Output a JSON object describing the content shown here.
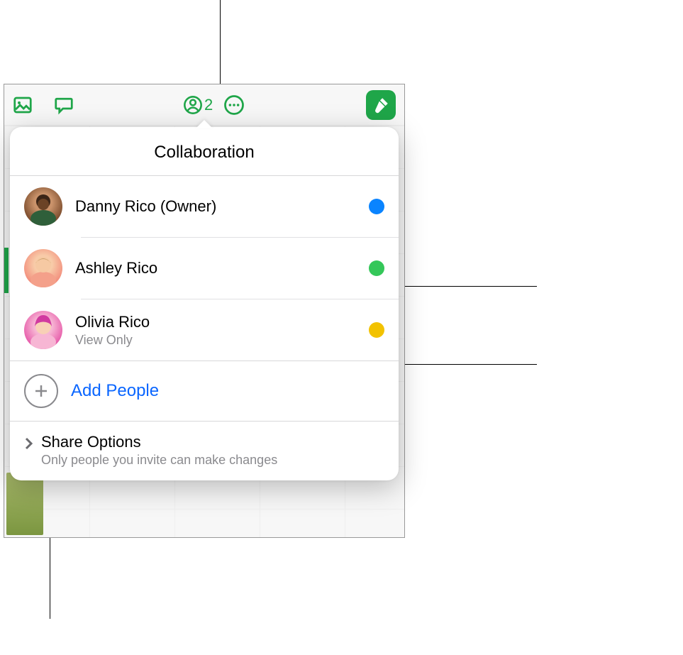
{
  "toolbar": {
    "collaboration_count": "2"
  },
  "popover": {
    "title": "Collaboration",
    "people": [
      {
        "name": "Danny Rico (Owner)",
        "sub": "",
        "dot_class": "dot-blue"
      },
      {
        "name": "Ashley Rico",
        "sub": "",
        "dot_class": "dot-green"
      },
      {
        "name": "Olivia Rico",
        "sub": "View Only",
        "dot_class": "dot-yellow"
      }
    ],
    "add_people_label": "Add People",
    "share_options": {
      "title": "Share Options",
      "subtitle": "Only people you invite can make changes"
    }
  }
}
